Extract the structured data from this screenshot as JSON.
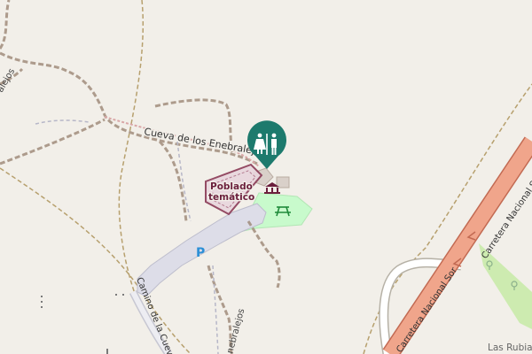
{
  "map": {
    "colors": {
      "background": "#f2efe9",
      "track": "#a18d7c",
      "path": "#8d8da6",
      "boundary": "#b7a06e",
      "primary_road": "#e8856a",
      "primary_road_casing": "#c26a52",
      "park": "#c8facc",
      "meadow": "#cdebb0",
      "poi_accent": "#1d7a6d",
      "museum_area": "#8a3a56",
      "parking": "#2b8fd6"
    },
    "labels": {
      "cave_track": "Cueva de los Enebralejos",
      "themed_village_line1": "Poblado",
      "themed_village_line2": "temático",
      "camino_road": "Camino de la Cueva",
      "enebralejos_partial": "nebralejos",
      "enebralejos_left_partial": "alejos",
      "carretera_upper": "Carretera Nacional Soria a",
      "carretera_lower": "Carretera Nacional Sor",
      "place_las_rubias": "Las Rubia",
      "parking_symbol": "P"
    },
    "icons": {
      "toilets": "toilets-icon",
      "museum": "museum-icon",
      "picnic": "picnic-table-icon",
      "trees": "tree-icon",
      "oneway": "oneway-arrow-icon"
    }
  }
}
